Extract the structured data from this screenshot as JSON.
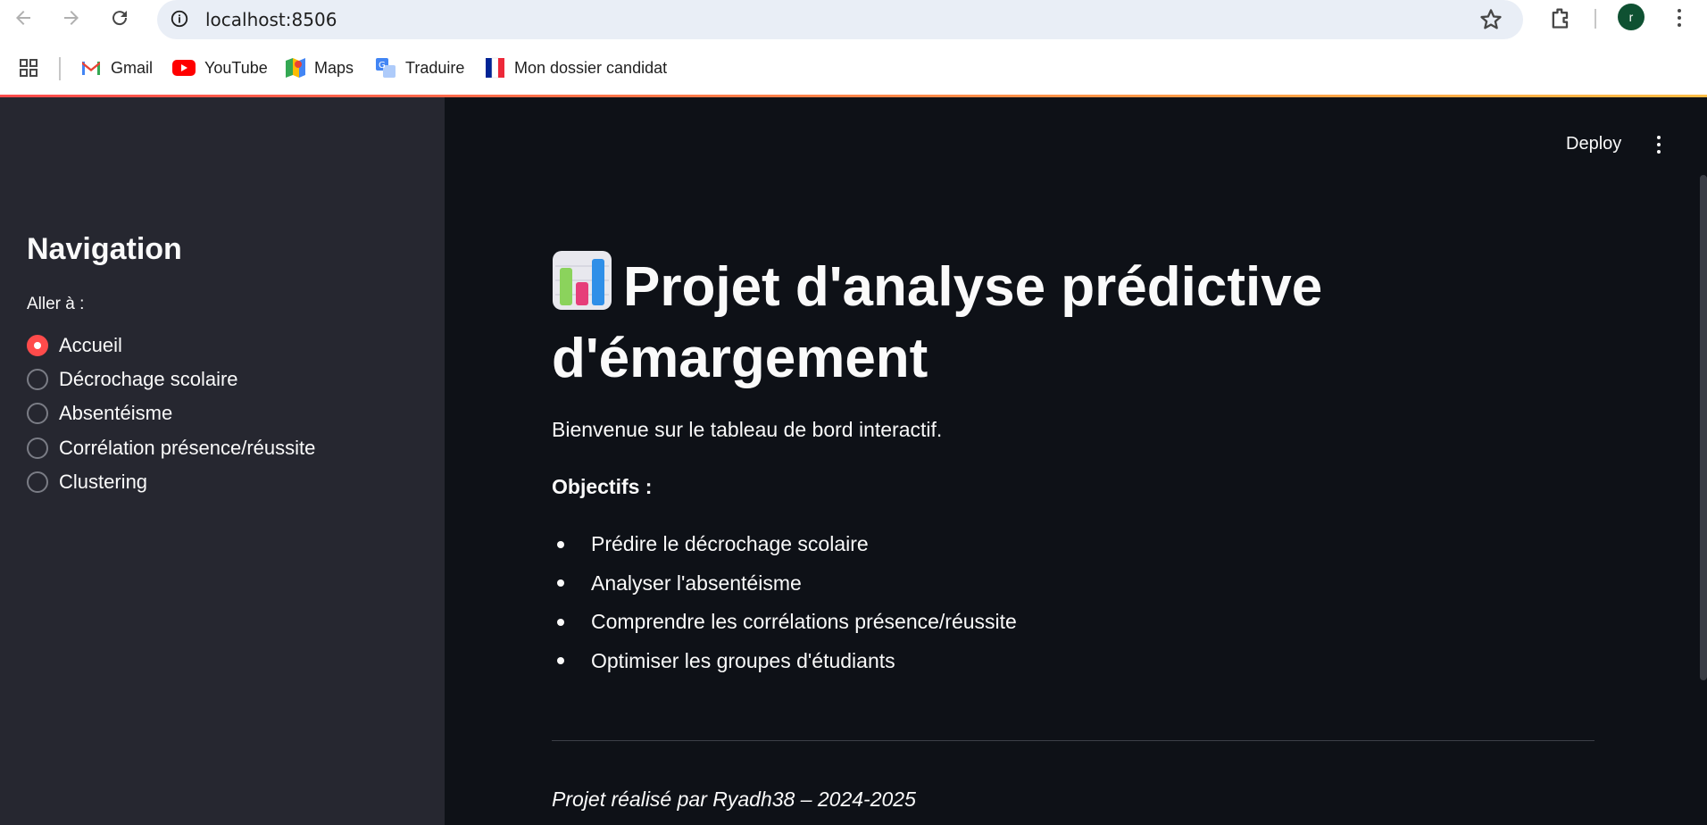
{
  "browser": {
    "url": "localhost:8506",
    "profile_initial": "r",
    "bookmarks": [
      {
        "label": "Gmail",
        "icon": "gmail-icon"
      },
      {
        "label": "YouTube",
        "icon": "youtube-icon"
      },
      {
        "label": "Maps",
        "icon": "maps-icon"
      },
      {
        "label": "Traduire",
        "icon": "translate-icon"
      },
      {
        "label": "Mon dossier candidat",
        "icon": "french-flag-icon"
      }
    ]
  },
  "sidebar": {
    "title": "Navigation",
    "radio_label": "Aller à :",
    "options": [
      {
        "label": "Accueil",
        "selected": true
      },
      {
        "label": "Décrochage scolaire",
        "selected": false
      },
      {
        "label": "Absentéisme",
        "selected": false
      },
      {
        "label": "Corrélation présence/réussite",
        "selected": false
      },
      {
        "label": "Clustering",
        "selected": false
      }
    ]
  },
  "header": {
    "deploy_label": "Deploy"
  },
  "main": {
    "title": "Projet d'analyse prédictive d'émargement",
    "welcome": "Bienvenue sur le tableau de bord interactif.",
    "objectives_label": "Objectifs :",
    "objectives": [
      "Prédire le décrochage scolaire",
      "Analyser l'absentéisme",
      "Comprendre les corrélations présence/réussite",
      "Optimiser les groupes d'étudiants"
    ],
    "footer": "Projet réalisé par Ryadh38 – 2024-2025"
  },
  "colors": {
    "accent": "#ff4b4b",
    "sidebar_bg": "#262730",
    "main_bg": "#0e1117",
    "text": "#fafafa"
  }
}
